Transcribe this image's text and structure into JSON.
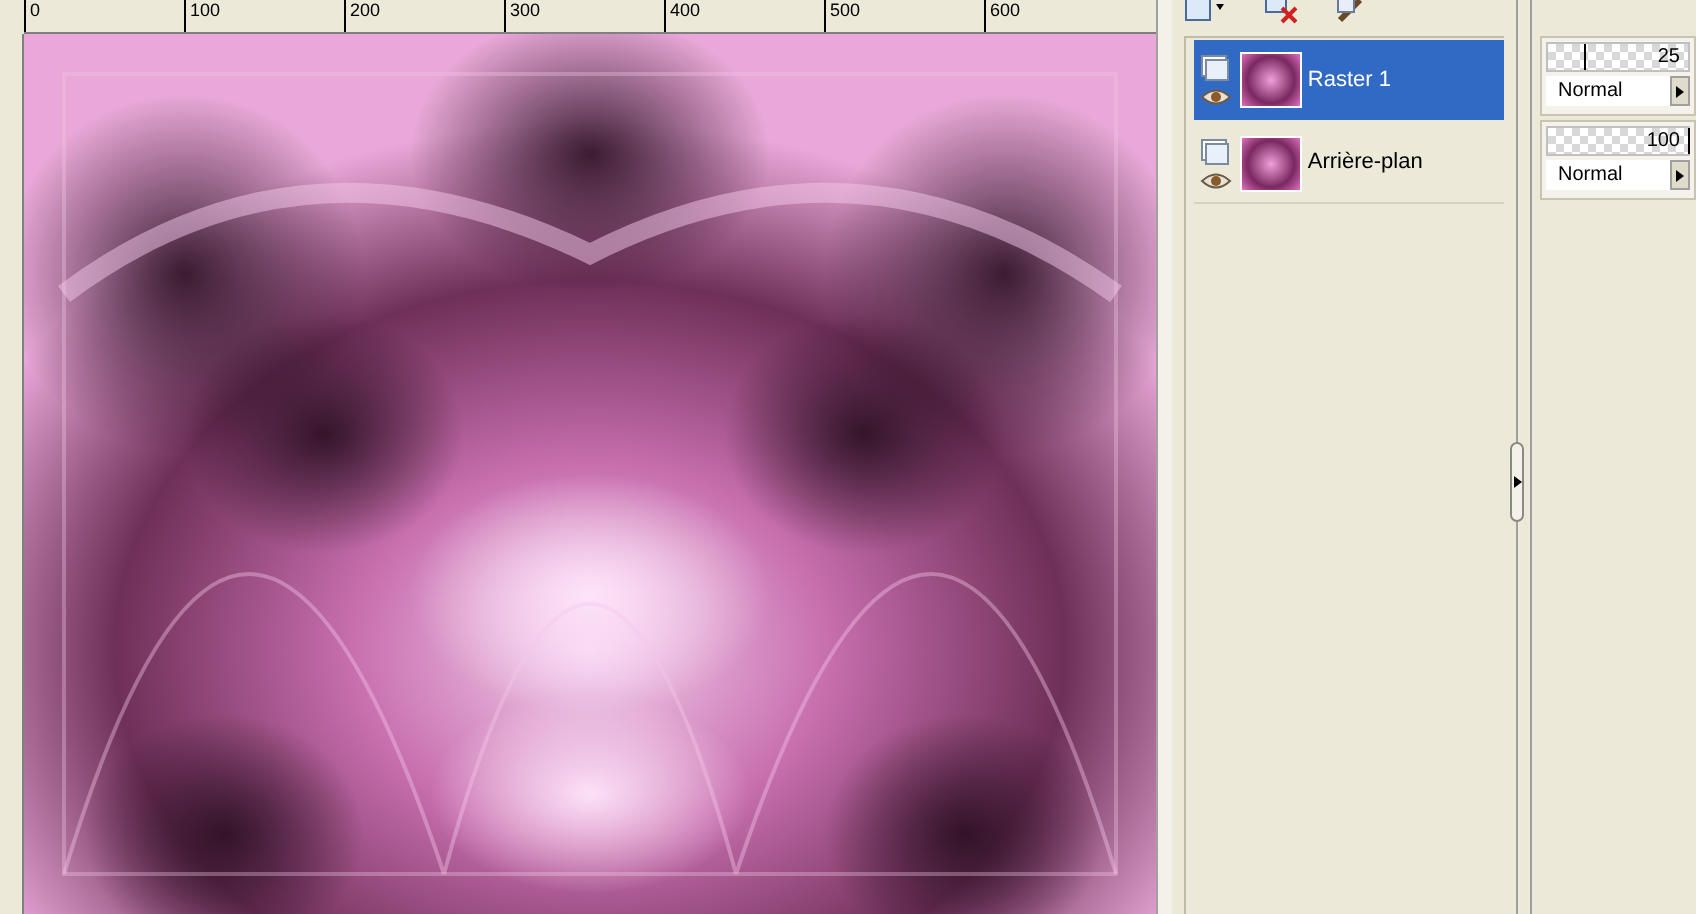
{
  "ruler": {
    "ticks": [
      "0",
      "100",
      "200",
      "300",
      "400",
      "500",
      "600"
    ]
  },
  "layers": [
    {
      "name": "Raster 1",
      "selected": true,
      "visible": true,
      "opacity": "25",
      "level": 0.25,
      "blend_mode": "Normal"
    },
    {
      "name": "Arrière-plan",
      "selected": false,
      "visible": true,
      "opacity": "100",
      "level": 1,
      "blend_mode": "Normal"
    }
  ]
}
